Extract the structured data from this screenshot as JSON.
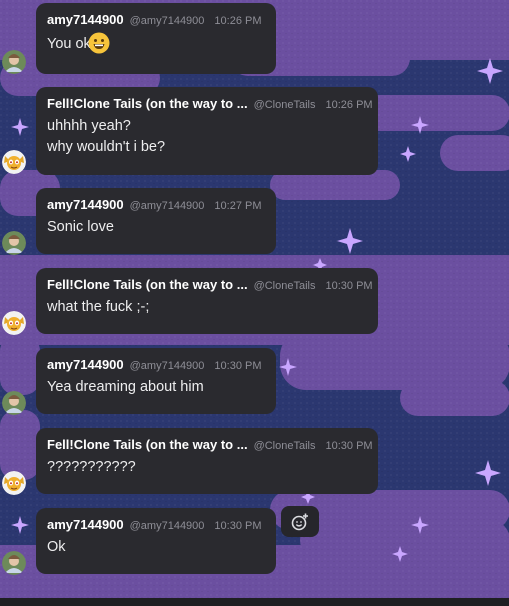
{
  "colors": {
    "bubble": "#2a2a2f",
    "background_sky": "#2b3770",
    "background_purple": "#6b4fa0",
    "muted_text": "#8e8e96"
  },
  "messages": [
    {
      "author": "amy7144900",
      "handle": "@amy7144900",
      "time": "10:26 PM",
      "lines": [
        "You ok"
      ],
      "emoji": "grinning-face-emoji",
      "avatar": "amy-avatar"
    },
    {
      "author": "Fell!Clone Tails (on the way to ...",
      "handle": "@CloneTails",
      "time": "10:26 PM",
      "lines": [
        "uhhhh yeah?",
        "why wouldn't i be?"
      ],
      "avatar": "clonetails-avatar"
    },
    {
      "author": "amy7144900",
      "handle": "@amy7144900",
      "time": "10:27 PM",
      "lines": [
        "Sonic love"
      ],
      "avatar": "amy-avatar"
    },
    {
      "author": "Fell!Clone Tails (on the way to ...",
      "handle": "@CloneTails",
      "time": "10:30 PM",
      "lines": [
        "what the fuck ;-;"
      ],
      "avatar": "clonetails-avatar"
    },
    {
      "author": "amy7144900",
      "handle": "@amy7144900",
      "time": "10:30 PM",
      "lines": [
        "Yea dreaming about him"
      ],
      "avatar": "amy-avatar"
    },
    {
      "author": "Fell!Clone Tails (on the way to ...",
      "handle": "@CloneTails",
      "time": "10:30 PM",
      "lines": [
        "???????????"
      ],
      "avatar": "clonetails-avatar"
    },
    {
      "author": "amy7144900",
      "handle": "@amy7144900",
      "time": "10:30 PM",
      "lines": [
        "Ok"
      ],
      "avatar": "amy-avatar"
    }
  ],
  "reaction_button": {
    "icon": "add-reaction-icon"
  }
}
